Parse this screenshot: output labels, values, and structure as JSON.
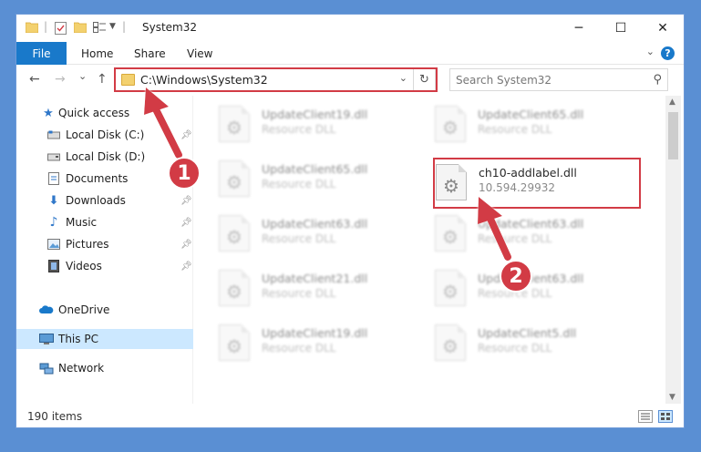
{
  "window": {
    "title": "System32",
    "minimize": "─",
    "maximize": "☐",
    "close": "✕"
  },
  "ribbon": {
    "tabs": [
      "File",
      "Home",
      "Share",
      "View"
    ],
    "help": "?"
  },
  "nav": {
    "back": "←",
    "forward": "→",
    "recent": "⌄",
    "up": "↑",
    "address": "C:\\Windows\\System32",
    "refresh": "↻",
    "search_placeholder": "Search System32"
  },
  "sidebar": {
    "items": [
      {
        "label": "Quick access",
        "icon": "star-icon",
        "pinned": false
      },
      {
        "label": "Local Disk (C:)",
        "icon": "drive-icon",
        "pinned": true
      },
      {
        "label": "Local Disk (D:)",
        "icon": "drive-icon",
        "pinned": false
      },
      {
        "label": "Documents",
        "icon": "documents-icon",
        "pinned": true
      },
      {
        "label": "Downloads",
        "icon": "download-icon",
        "pinned": true
      },
      {
        "label": "Music",
        "icon": "music-icon",
        "pinned": true
      },
      {
        "label": "Pictures",
        "icon": "pictures-icon",
        "pinned": true
      },
      {
        "label": "Videos",
        "icon": "videos-icon",
        "pinned": true
      },
      {
        "label": "OneDrive",
        "icon": "cloud-icon",
        "pinned": false
      },
      {
        "label": "This PC",
        "icon": "computer-icon",
        "pinned": false,
        "selected": true
      },
      {
        "label": "Network",
        "icon": "network-icon",
        "pinned": false
      }
    ]
  },
  "files": [
    {
      "name": "UpdateClient19.dll",
      "type": "Resource DLL"
    },
    {
      "name": "UpdateClient65.dll",
      "type": "Resource DLL"
    },
    {
      "name": "UpdateClient65.dll",
      "type": "Resource DLL"
    },
    {
      "name": "ch10-addlabel.dll",
      "type": "10.594.29932",
      "highlighted": true
    },
    {
      "name": "UpdateClient63.dll",
      "type": "Resource DLL"
    },
    {
      "name": "UpdateClient63.dll",
      "type": "Resource DLL"
    },
    {
      "name": "UpdateClient21.dll",
      "type": "Resource DLL"
    },
    {
      "name": "UpdateClient63.dll",
      "type": "Resource DLL"
    },
    {
      "name": "UpdateClient19.dll",
      "type": "Resource DLL"
    },
    {
      "name": "UpdateClient5.dll",
      "type": "Resource DLL"
    }
  ],
  "status": {
    "item_count": "190 items"
  },
  "annotations": {
    "step1": "1",
    "step2": "2",
    "color": "#d23b45"
  }
}
